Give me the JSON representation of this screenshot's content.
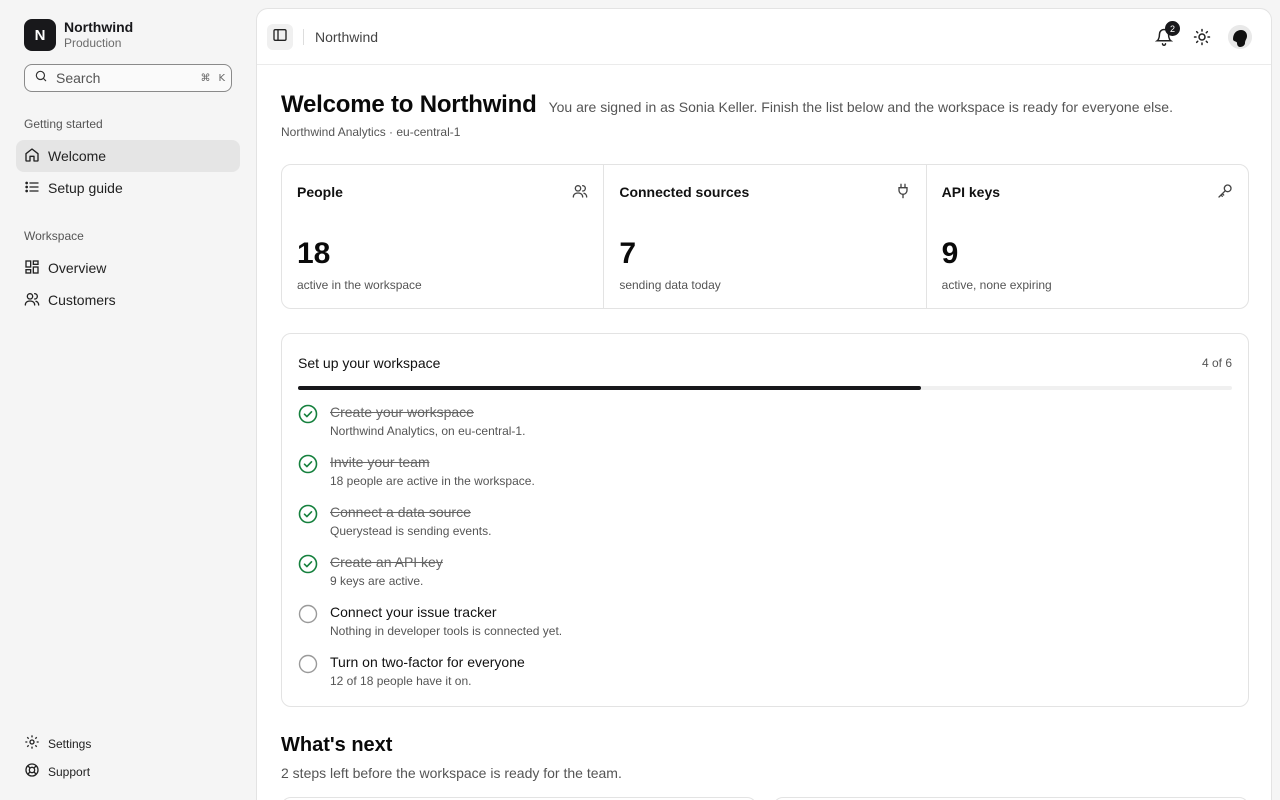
{
  "sidebar": {
    "brand": {
      "initial": "N",
      "name": "Northwind",
      "env": "Production"
    },
    "search": {
      "placeholder": "Search",
      "kbd1": "⌘",
      "kbd2": "K"
    },
    "groups": [
      {
        "label": "Getting started",
        "items": [
          {
            "label": "Welcome",
            "icon": "home-icon",
            "active": true
          },
          {
            "label": "Setup guide",
            "icon": "list-icon"
          }
        ]
      },
      {
        "label": "Workspace",
        "items": [
          {
            "label": "Overview",
            "icon": "grid-icon"
          },
          {
            "label": "Customers",
            "icon": "users-icon"
          }
        ]
      }
    ],
    "footer": [
      {
        "label": "Settings",
        "icon": "gear-icon"
      },
      {
        "label": "Support",
        "icon": "lifebuoy-icon"
      }
    ]
  },
  "topbar": {
    "breadcrumb": "Northwind",
    "notifications": "2"
  },
  "page": {
    "title": "Welcome to Northwind",
    "subtitle": "You are signed in as Sonia Keller. Finish the list below and the workspace is ready for everyone else.",
    "meta": "Northwind Analytics · eu-central-1"
  },
  "stats": [
    {
      "label": "People",
      "value": "18",
      "desc": "active in the workspace",
      "icon": "users-icon"
    },
    {
      "label": "Connected sources",
      "value": "7",
      "desc": "sending data today",
      "icon": "plug-icon"
    },
    {
      "label": "API keys",
      "value": "9",
      "desc": "active, none expiring",
      "icon": "key-icon"
    }
  ],
  "setup": {
    "title": "Set up your workspace",
    "count": "4 of 6",
    "progress": 0.667,
    "tasks": [
      {
        "title": "Create your workspace",
        "desc": "Northwind Analytics, on eu-central-1.",
        "done": true
      },
      {
        "title": "Invite your team",
        "desc": "18 people are active in the workspace.",
        "done": true
      },
      {
        "title": "Connect a data source",
        "desc": "Querystead is sending events.",
        "done": true
      },
      {
        "title": "Create an API key",
        "desc": "9 keys are active.",
        "done": true
      },
      {
        "title": "Connect your issue tracker",
        "desc": "Nothing in developer tools is connected yet.",
        "done": false
      },
      {
        "title": "Turn on two-factor for everyone",
        "desc": "12 of 18 people have it on.",
        "done": false
      }
    ]
  },
  "next": {
    "title": "What's next",
    "subtitle": "2 steps left before the workspace is ready for the team."
  },
  "colors": {
    "accent": "#18181b",
    "success": "#15803d",
    "sidebar_bg": "#f5f5f5"
  }
}
